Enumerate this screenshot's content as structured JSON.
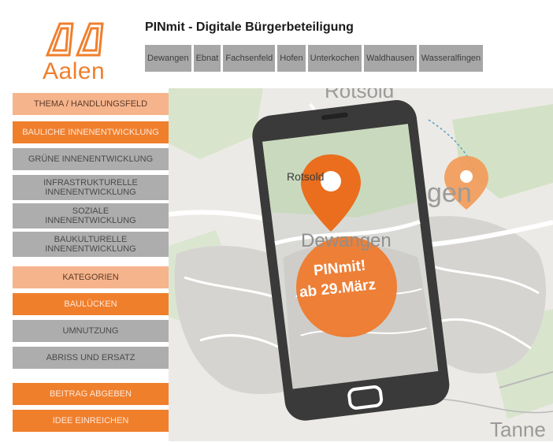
{
  "brand": {
    "logo_text": "Aalen",
    "accent": "#f07f2c",
    "light_accent": "#f6b48c",
    "gray": "#adadad"
  },
  "header": {
    "title": "PINmit - Digitale Bürgerbeteiligung"
  },
  "districts": [
    "Dewangen",
    "Ebnat",
    "Fachsenfeld",
    "Hofen",
    "Unterkochen",
    "Waldhausen",
    "Wasseralfingen"
  ],
  "sidebar": {
    "theme_header": "THEMA / HANDLUNGSFELD",
    "themes": [
      {
        "label": "BAULICHE INNENENTWICKLUNG",
        "style": "org"
      },
      {
        "label": "GRÜNE INNENENTWICKLUNG",
        "style": "gry"
      },
      {
        "label": "INFRASTRUKTURELLE INNENENTWICKLUNG",
        "style": "gry"
      },
      {
        "label": "SOZIALE INNENENTWICKLUNG",
        "style": "gry"
      },
      {
        "label": "BAUKULTURELLE INNENENTWICKLUNG",
        "style": "gry"
      }
    ],
    "category_header": "KATEGORIEN",
    "categories": [
      {
        "label": "BAULÜCKEN",
        "style": "org"
      },
      {
        "label": "UMNUTZUNG",
        "style": "gry"
      },
      {
        "label": "ABRISS UND ERSATZ",
        "style": "gry"
      }
    ],
    "actions": [
      {
        "label": "BEITRAG ABGEBEN"
      },
      {
        "label": "IDEE EINREICHEN"
      }
    ]
  },
  "map": {
    "labels": {
      "top": "Rotsold",
      "right": "gen",
      "bottom": "Tanne"
    }
  },
  "phone": {
    "screen_label": "Dewangen",
    "pin_label": "Rotsold",
    "promo_line1": "PINmit!",
    "promo_line2": "ab 29.März"
  }
}
